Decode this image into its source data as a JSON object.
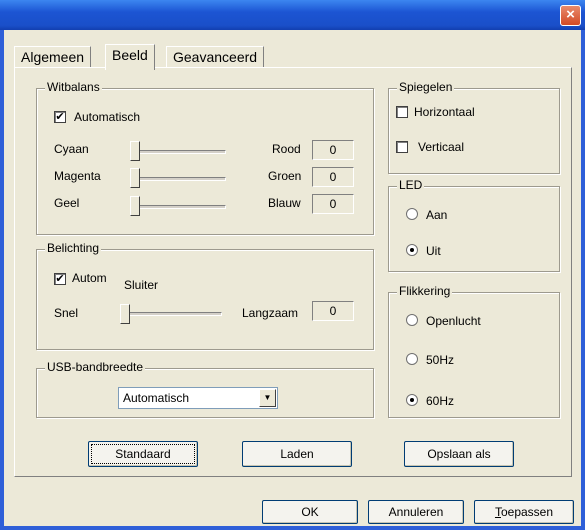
{
  "titlebar": {
    "close_label": "×"
  },
  "tabs": [
    "Algemeen",
    "Beeld",
    "Geavanceerd"
  ],
  "active_tab": "Beeld",
  "witbalans": {
    "title": "Witbalans",
    "auto_label": "Automatisch",
    "auto_checked": true,
    "rows": [
      {
        "left": "Cyaan",
        "right": "Rood",
        "value": "0"
      },
      {
        "left": "Magenta",
        "right": "Groen",
        "value": "0"
      },
      {
        "left": "Geel",
        "right": "Blauw",
        "value": "0"
      }
    ]
  },
  "belichting": {
    "title": "Belichting",
    "auto_label": "Autom",
    "auto_checked": true,
    "shutter_label": "Sluiter",
    "left": "Snel",
    "right": "Langzaam",
    "value": "0"
  },
  "usb": {
    "title": "USB-bandbreedte",
    "selected": "Automatisch",
    "arrow": "▼"
  },
  "spiegelen": {
    "title": "Spiegelen",
    "horizontal": "Horizontaal",
    "vertical": "Verticaal",
    "horizontal_checked": false,
    "vertical_checked": false
  },
  "led": {
    "title": "LED",
    "options": [
      "Aan",
      "Uit"
    ],
    "selected": "Uit"
  },
  "flikkering": {
    "title": "Flikkering",
    "options": [
      "Openlucht",
      "50Hz",
      "60Hz"
    ],
    "selected": "60Hz"
  },
  "buttons": {
    "standaard": "Standaard",
    "laden": "Laden",
    "opslaan": "Opslaan als"
  },
  "footer": {
    "ok": "OK",
    "annuleren": "Annuleren",
    "toepassen_first": "T",
    "toepassen_rest": "oepassen"
  }
}
